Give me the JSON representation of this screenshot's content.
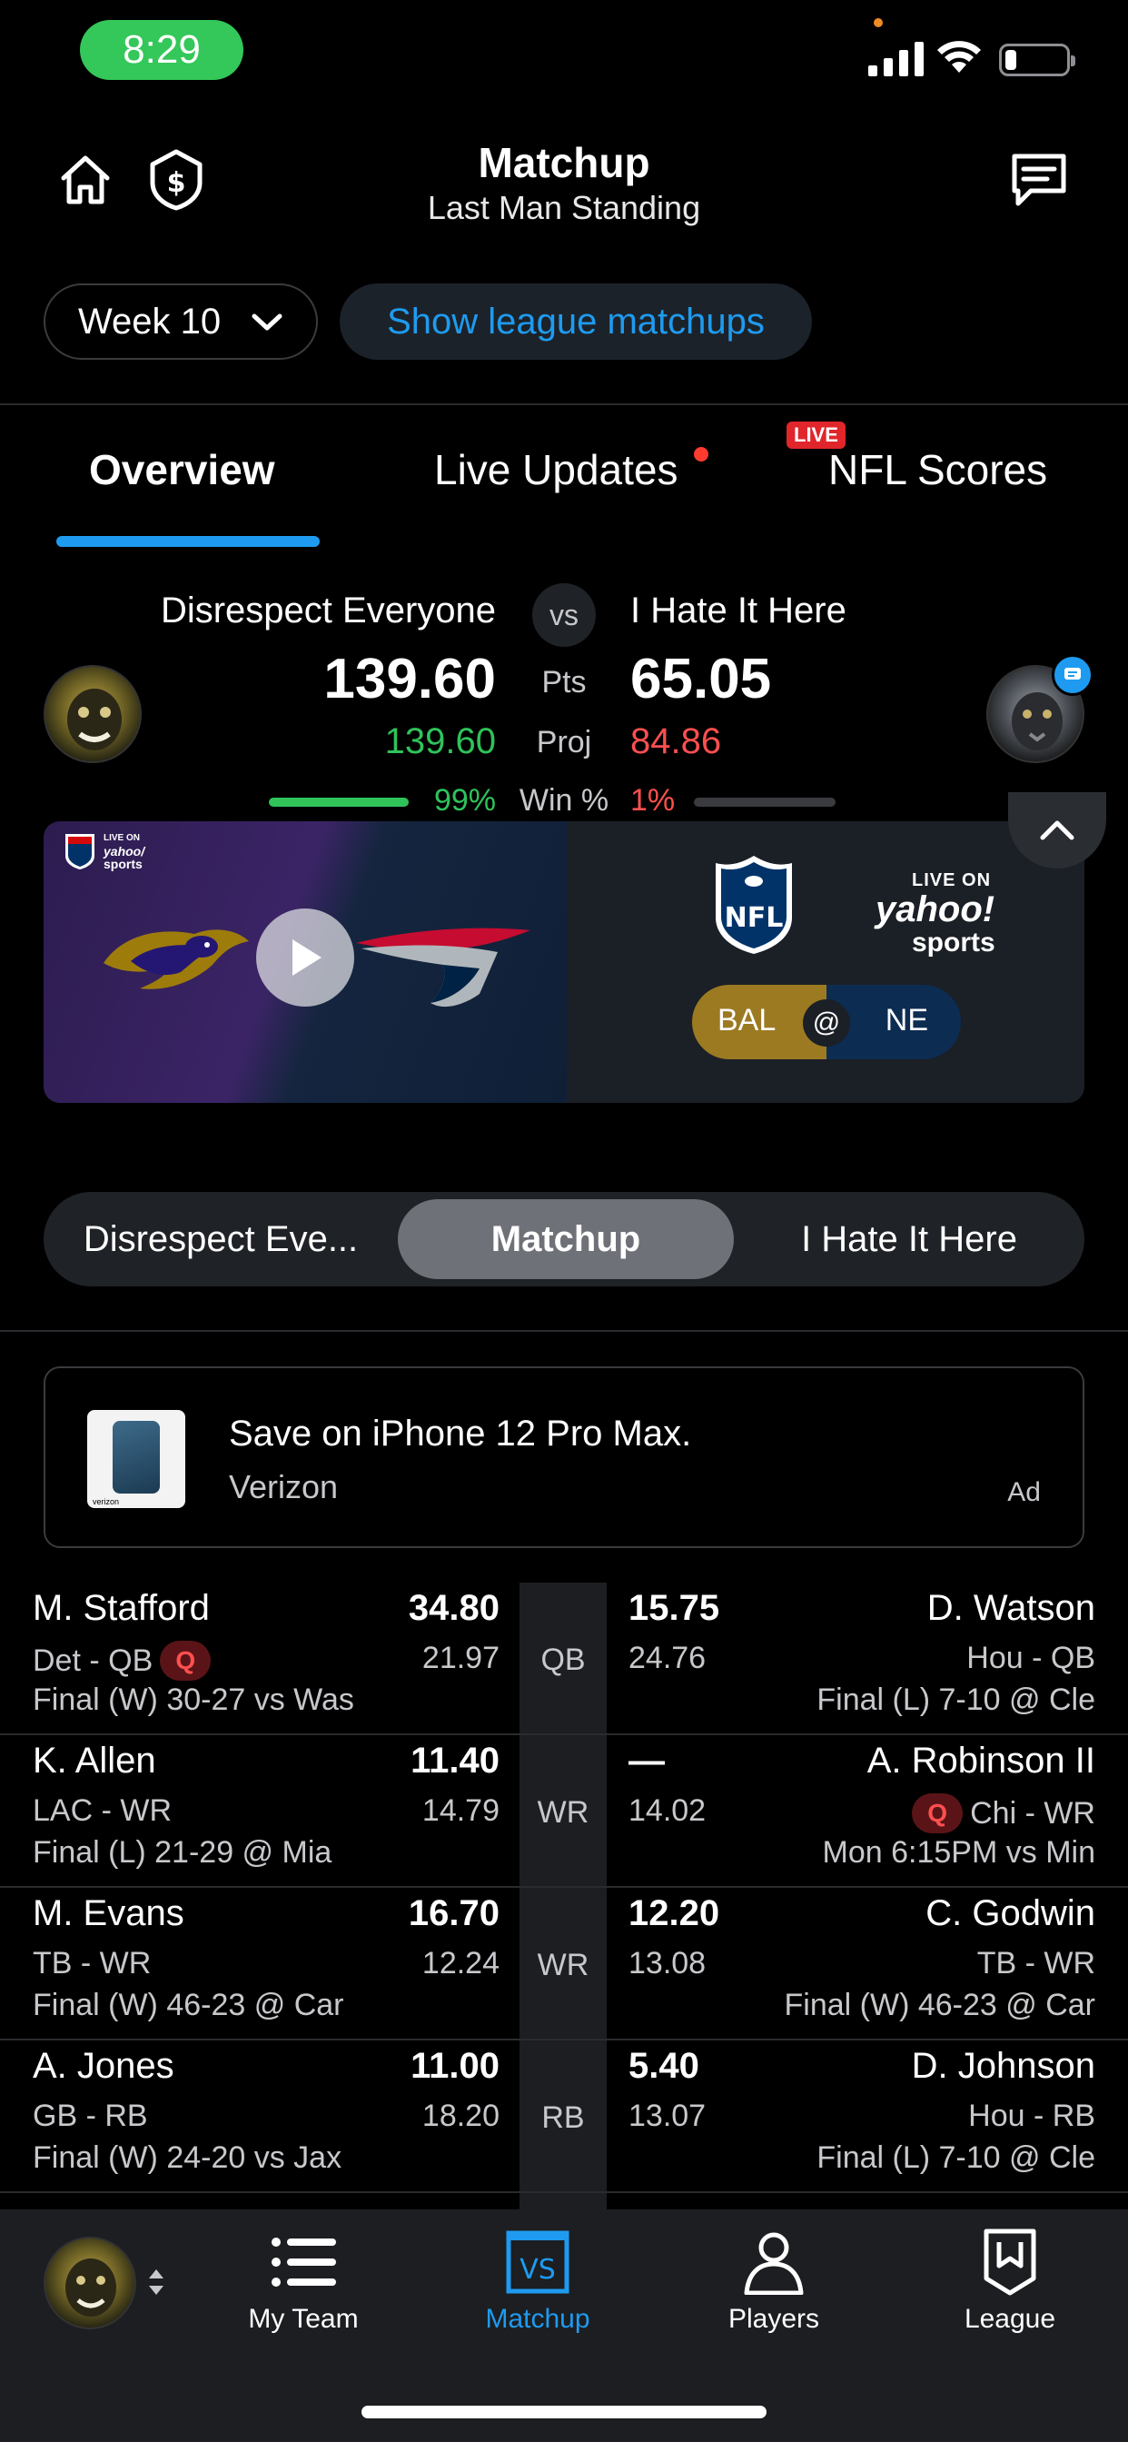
{
  "status": {
    "time": "8:29"
  },
  "header": {
    "title": "Matchup",
    "subtitle": "Last Man Standing"
  },
  "week": {
    "label": "Week 10",
    "league_btn": "Show league matchups"
  },
  "tabs": [
    {
      "label": "Overview",
      "active": true
    },
    {
      "label": "Live Updates",
      "active": false
    },
    {
      "label": "NFL Scores",
      "active": false,
      "badge": "LIVE"
    }
  ],
  "matchup": {
    "left_team": "Disrespect Everyone",
    "right_team": "I Hate It Here",
    "vs": "vs",
    "left_pts": "139.60",
    "right_pts": "65.05",
    "pts_label": "Pts",
    "left_proj": "139.60",
    "right_proj": "84.86",
    "proj_label": "Proj",
    "left_win": "99%",
    "right_win": "1%",
    "win_label": "Win %",
    "left_win_fraction": 0.99,
    "right_win_fraction": 0.01
  },
  "video": {
    "mini_brand_top": "LIVE ON",
    "mini_brand_mid": "yahoo/",
    "mini_brand_bottom": "sports",
    "brand_top": "LIVE ON",
    "brand_mid": "yahoo!",
    "brand_bottom": "sports",
    "away": "BAL",
    "at": "@",
    "home": "NE"
  },
  "segment": [
    "Disrespect Eve...",
    "Matchup",
    "I Hate It Here"
  ],
  "ad": {
    "title": "Save on iPhone 12 Pro Max.",
    "sponsor": "Verizon",
    "label": "Ad",
    "img_text": "verizon"
  },
  "roster": [
    {
      "left": {
        "name": "M. Stafford",
        "info": "Det - QB",
        "q": "Q",
        "game": "Final (W) 30-27 vs Was",
        "pts": "34.80",
        "proj": "21.97"
      },
      "pos": "QB",
      "right": {
        "name": "D. Watson",
        "info": "Hou - QB",
        "q": "",
        "game": "Final (L) 7-10 @ Cle",
        "pts": "15.75",
        "proj": "24.76"
      }
    },
    {
      "left": {
        "name": "K. Allen",
        "info": "LAC - WR",
        "q": "",
        "game": "Final (L) 21-29 @ Mia",
        "pts": "11.40",
        "proj": "14.79"
      },
      "pos": "WR",
      "right": {
        "name": "A. Robinson II",
        "info": "Chi - WR",
        "q": "Q",
        "game": "Mon 6:15PM vs Min",
        "pts": "—",
        "proj": "14.02"
      }
    },
    {
      "left": {
        "name": "M. Evans",
        "info": "TB - WR",
        "q": "",
        "game": "Final (W) 46-23 @ Car",
        "pts": "16.70",
        "proj": "12.24"
      },
      "pos": "WR",
      "right": {
        "name": "C. Godwin",
        "info": "TB - WR",
        "q": "",
        "game": "Final (W) 46-23 @ Car",
        "pts": "12.20",
        "proj": "13.08"
      }
    },
    {
      "left": {
        "name": "A. Jones",
        "info": "GB - RB",
        "q": "",
        "game": "Final (W) 24-20 vs Jax",
        "pts": "11.00",
        "proj": "18.20"
      },
      "pos": "RB",
      "right": {
        "name": "D. Johnson",
        "info": "Hou - RB",
        "q": "",
        "game": "Final (L) 7-10 @ Cle",
        "pts": "5.40",
        "proj": "13.07"
      }
    }
  ],
  "nav": [
    {
      "label": "My Team",
      "active": false
    },
    {
      "label": "Matchup",
      "active": true,
      "icon_text": "VS"
    },
    {
      "label": "Players",
      "active": false
    },
    {
      "label": "League",
      "active": false
    }
  ],
  "colors": {
    "accent": "#1e9bf0",
    "win": "#2fc35a",
    "lose": "#ff4f4f",
    "time_pill": "#34c759"
  }
}
